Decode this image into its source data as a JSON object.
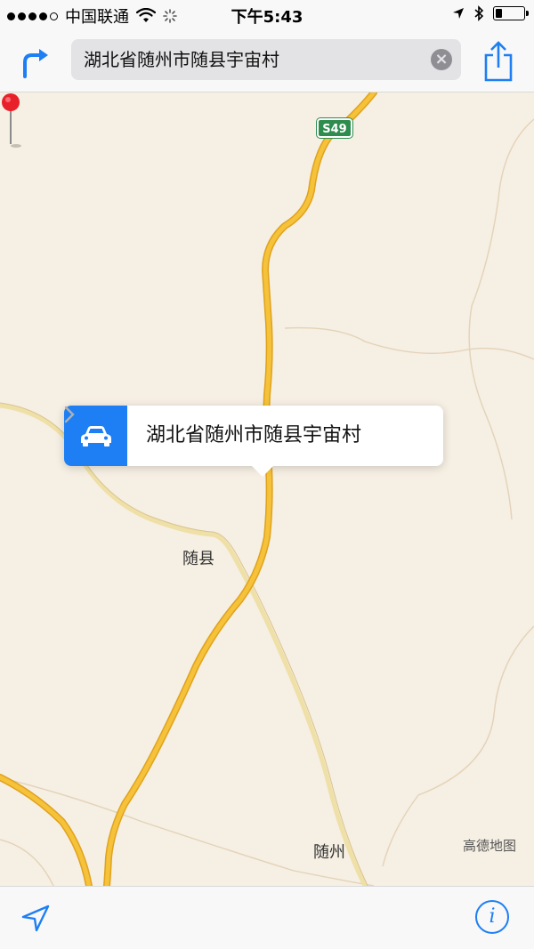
{
  "status_bar": {
    "carrier": "中国联通",
    "time": "下午5:43",
    "battery_level": 0.25
  },
  "nav_bar": {
    "search_value": "湖北省随州市随县宇宙村",
    "clear_symbol": "×",
    "icons": {
      "directions": "directions-arrow-icon",
      "share": "share-icon"
    }
  },
  "map": {
    "route_shield": "S49",
    "labels": {
      "suixian": "随县",
      "suizhou": "随州",
      "attribution": "高德地图"
    },
    "colors": {
      "land": "#f6efe3",
      "highway": "#f2b72c",
      "road": "#f1e1a8",
      "boundary": "#e0cdb3",
      "accent": "#1d7ff3",
      "pin": "#e8202a"
    }
  },
  "callout": {
    "title": "湖北省随州市随县宇宙村",
    "icon": "car-icon"
  },
  "toolbar": {
    "info_symbol": "i",
    "icons": {
      "locate": "location-arrow-icon",
      "info": "info-icon"
    }
  }
}
